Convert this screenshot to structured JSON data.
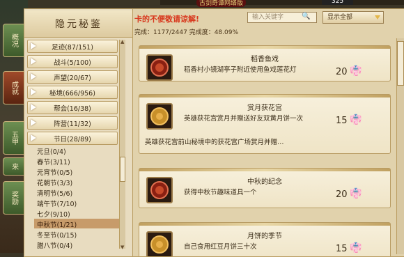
{
  "top_bar": {
    "announcement": "古剑奇谭网络版",
    "number": "325"
  },
  "side_tabs": [
    "概况",
    "成就",
    "五甲",
    "来",
    "奖励"
  ],
  "panel": {
    "title": "隐元秘鉴",
    "categories": [
      {
        "label": "足迹(87/151)"
      },
      {
        "label": "战斗(5/100)"
      },
      {
        "label": "声望(20/67)"
      },
      {
        "label": "秘境(666/956)"
      },
      {
        "label": "帮会(16/38)"
      },
      {
        "label": "阵营(11/32)"
      },
      {
        "label": "节日(28/89)"
      }
    ],
    "subitems": [
      {
        "label": "元旦(0/4)"
      },
      {
        "label": "春节(3/11)"
      },
      {
        "label": "元宵节(0/5)"
      },
      {
        "label": "花朝节(3/3)"
      },
      {
        "label": "清明节(5/6)"
      },
      {
        "label": "端午节(7/10)"
      },
      {
        "label": "七夕(9/10)"
      },
      {
        "label": "中秋节(1/21)"
      },
      {
        "label": "冬至节(0/15)"
      },
      {
        "label": "腊八节(0/4)"
      }
    ]
  },
  "main": {
    "banner": "卡的不便敬请谅解!",
    "search_placeholder": "输入关键字",
    "filter": "显示全部",
    "stats": "完成：1177/2447 完成度：48.09%",
    "achievements": [
      {
        "title": "稻香鱼戏",
        "desc": "稻香村小镜湖亭子附近使用鱼戏莲花灯",
        "points": "20",
        "icon": "red-medal-icon",
        "desc2": ""
      },
      {
        "title": "赏月获花宫",
        "desc": "英雄获花宫赏月并赠送好友双黄月饼一次",
        "points": "15",
        "icon": "mooncake-icon",
        "desc2": "英雄获花宫前山秘境中的获花宫广场赏月并赠…"
      },
      {
        "title": "中秋的纪念",
        "desc": "获得中秋节趣味道具一个",
        "points": "20",
        "icon": "red-medal-icon",
        "desc2": ""
      },
      {
        "title": "月饼的季节",
        "desc": "自己食用红豆月饼三十次",
        "points": "15",
        "icon": "mooncake-icon",
        "desc2": ""
      }
    ]
  }
}
